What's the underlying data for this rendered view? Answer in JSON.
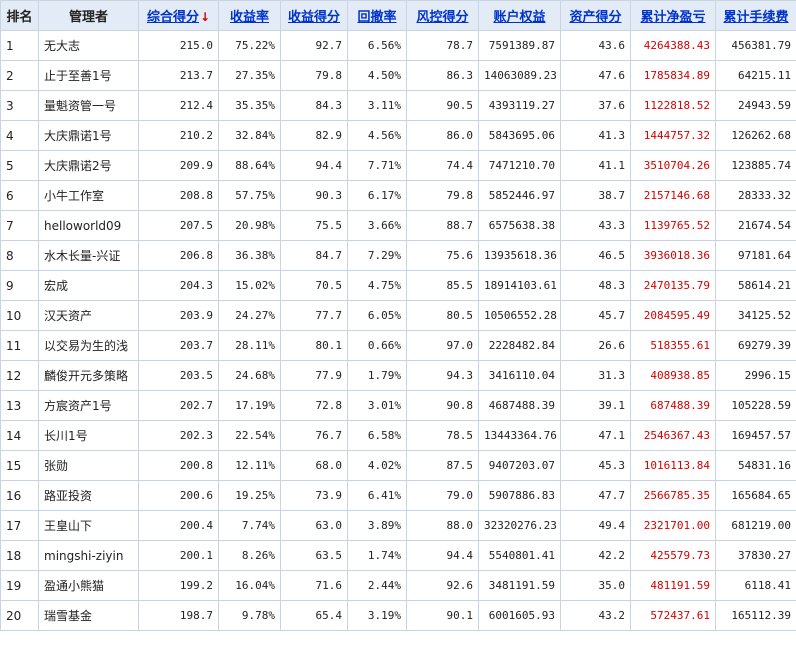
{
  "headers": [
    {
      "label": "排名",
      "link": false
    },
    {
      "label": "管理者",
      "link": false
    },
    {
      "label": "综合得分",
      "link": true,
      "sort": "↓"
    },
    {
      "label": "收益率",
      "link": true
    },
    {
      "label": "收益得分",
      "link": true
    },
    {
      "label": "回撤率",
      "link": true
    },
    {
      "label": "风控得分",
      "link": true
    },
    {
      "label": "账户权益",
      "link": true
    },
    {
      "label": "资产得分",
      "link": true
    },
    {
      "label": "累计净盈亏",
      "link": true
    },
    {
      "label": "累计手续费",
      "link": true
    }
  ],
  "accent_profit_color": "#d40000",
  "rows": [
    {
      "rank": "1",
      "manager": "无大志",
      "score": "215.0",
      "return_rate": "75.22%",
      "return_score": "92.7",
      "drawdown": "6.56%",
      "risk_score": "78.7",
      "equity": "7591389.87",
      "asset_score": "43.6",
      "net_profit": "4264388.43",
      "fees": "456381.79"
    },
    {
      "rank": "2",
      "manager": "止于至善1号",
      "score": "213.7",
      "return_rate": "27.35%",
      "return_score": "79.8",
      "drawdown": "4.50%",
      "risk_score": "86.3",
      "equity": "14063089.23",
      "asset_score": "47.6",
      "net_profit": "1785834.89",
      "fees": "64215.11"
    },
    {
      "rank": "3",
      "manager": "量魁资管一号",
      "score": "212.4",
      "return_rate": "35.35%",
      "return_score": "84.3",
      "drawdown": "3.11%",
      "risk_score": "90.5",
      "equity": "4393119.27",
      "asset_score": "37.6",
      "net_profit": "1122818.52",
      "fees": "24943.59"
    },
    {
      "rank": "4",
      "manager": "大庆鼎诺1号",
      "score": "210.2",
      "return_rate": "32.84%",
      "return_score": "82.9",
      "drawdown": "4.56%",
      "risk_score": "86.0",
      "equity": "5843695.06",
      "asset_score": "41.3",
      "net_profit": "1444757.32",
      "fees": "126262.68"
    },
    {
      "rank": "5",
      "manager": "大庆鼎诺2号",
      "score": "209.9",
      "return_rate": "88.64%",
      "return_score": "94.4",
      "drawdown": "7.71%",
      "risk_score": "74.4",
      "equity": "7471210.70",
      "asset_score": "41.1",
      "net_profit": "3510704.26",
      "fees": "123885.74"
    },
    {
      "rank": "6",
      "manager": "小牛工作室",
      "score": "208.8",
      "return_rate": "57.75%",
      "return_score": "90.3",
      "drawdown": "6.17%",
      "risk_score": "79.8",
      "equity": "5852446.97",
      "asset_score": "38.7",
      "net_profit": "2157146.68",
      "fees": "28333.32"
    },
    {
      "rank": "7",
      "manager": "helloworld09",
      "score": "207.5",
      "return_rate": "20.98%",
      "return_score": "75.5",
      "drawdown": "3.66%",
      "risk_score": "88.7",
      "equity": "6575638.38",
      "asset_score": "43.3",
      "net_profit": "1139765.52",
      "fees": "21674.54"
    },
    {
      "rank": "8",
      "manager": "水木长量-兴证",
      "score": "206.8",
      "return_rate": "36.38%",
      "return_score": "84.7",
      "drawdown": "7.29%",
      "risk_score": "75.6",
      "equity": "13935618.36",
      "asset_score": "46.5",
      "net_profit": "3936018.36",
      "fees": "97181.64"
    },
    {
      "rank": "9",
      "manager": "宏成",
      "score": "204.3",
      "return_rate": "15.02%",
      "return_score": "70.5",
      "drawdown": "4.75%",
      "risk_score": "85.5",
      "equity": "18914103.61",
      "asset_score": "48.3",
      "net_profit": "2470135.79",
      "fees": "58614.21"
    },
    {
      "rank": "10",
      "manager": "汉天资产",
      "score": "203.9",
      "return_rate": "24.27%",
      "return_score": "77.7",
      "drawdown": "6.05%",
      "risk_score": "80.5",
      "equity": "10506552.28",
      "asset_score": "45.7",
      "net_profit": "2084595.49",
      "fees": "34125.52"
    },
    {
      "rank": "11",
      "manager": "以交易为生的浅",
      "score": "203.7",
      "return_rate": "28.11%",
      "return_score": "80.1",
      "drawdown": "0.66%",
      "risk_score": "97.0",
      "equity": "2228482.84",
      "asset_score": "26.6",
      "net_profit": "518355.61",
      "fees": "69279.39"
    },
    {
      "rank": "12",
      "manager": "麟俊开元多策略",
      "score": "203.5",
      "return_rate": "24.68%",
      "return_score": "77.9",
      "drawdown": "1.79%",
      "risk_score": "94.3",
      "equity": "3416110.04",
      "asset_score": "31.3",
      "net_profit": "408938.85",
      "fees": "2996.15"
    },
    {
      "rank": "13",
      "manager": "方宸资产1号",
      "score": "202.7",
      "return_rate": "17.19%",
      "return_score": "72.8",
      "drawdown": "3.01%",
      "risk_score": "90.8",
      "equity": "4687488.39",
      "asset_score": "39.1",
      "net_profit": "687488.39",
      "fees": "105228.59"
    },
    {
      "rank": "14",
      "manager": "长川1号",
      "score": "202.3",
      "return_rate": "22.54%",
      "return_score": "76.7",
      "drawdown": "6.58%",
      "risk_score": "78.5",
      "equity": "13443364.76",
      "asset_score": "47.1",
      "net_profit": "2546367.43",
      "fees": "169457.57"
    },
    {
      "rank": "15",
      "manager": "张勋",
      "score": "200.8",
      "return_rate": "12.11%",
      "return_score": "68.0",
      "drawdown": "4.02%",
      "risk_score": "87.5",
      "equity": "9407203.07",
      "asset_score": "45.3",
      "net_profit": "1016113.84",
      "fees": "54831.16"
    },
    {
      "rank": "16",
      "manager": "路亚投资",
      "score": "200.6",
      "return_rate": "19.25%",
      "return_score": "73.9",
      "drawdown": "6.41%",
      "risk_score": "79.0",
      "equity": "5907886.83",
      "asset_score": "47.7",
      "net_profit": "2566785.35",
      "fees": "165684.65"
    },
    {
      "rank": "17",
      "manager": "王皇山下",
      "score": "200.4",
      "return_rate": "7.74%",
      "return_score": "63.0",
      "drawdown": "3.89%",
      "risk_score": "88.0",
      "equity": "32320276.23",
      "asset_score": "49.4",
      "net_profit": "2321701.00",
      "fees": "681219.00"
    },
    {
      "rank": "18",
      "manager": "mingshi-ziyin",
      "score": "200.1",
      "return_rate": "8.26%",
      "return_score": "63.5",
      "drawdown": "1.74%",
      "risk_score": "94.4",
      "equity": "5540801.41",
      "asset_score": "42.2",
      "net_profit": "425579.73",
      "fees": "37830.27"
    },
    {
      "rank": "19",
      "manager": "盈通小熊猫",
      "score": "199.2",
      "return_rate": "16.04%",
      "return_score": "71.6",
      "drawdown": "2.44%",
      "risk_score": "92.6",
      "equity": "3481191.59",
      "asset_score": "35.0",
      "net_profit": "481191.59",
      "fees": "6118.41"
    },
    {
      "rank": "20",
      "manager": "瑞雪基金",
      "score": "198.7",
      "return_rate": "9.78%",
      "return_score": "65.4",
      "drawdown": "3.19%",
      "risk_score": "90.1",
      "equity": "6001605.93",
      "asset_score": "43.2",
      "net_profit": "572437.61",
      "fees": "165112.39"
    }
  ]
}
